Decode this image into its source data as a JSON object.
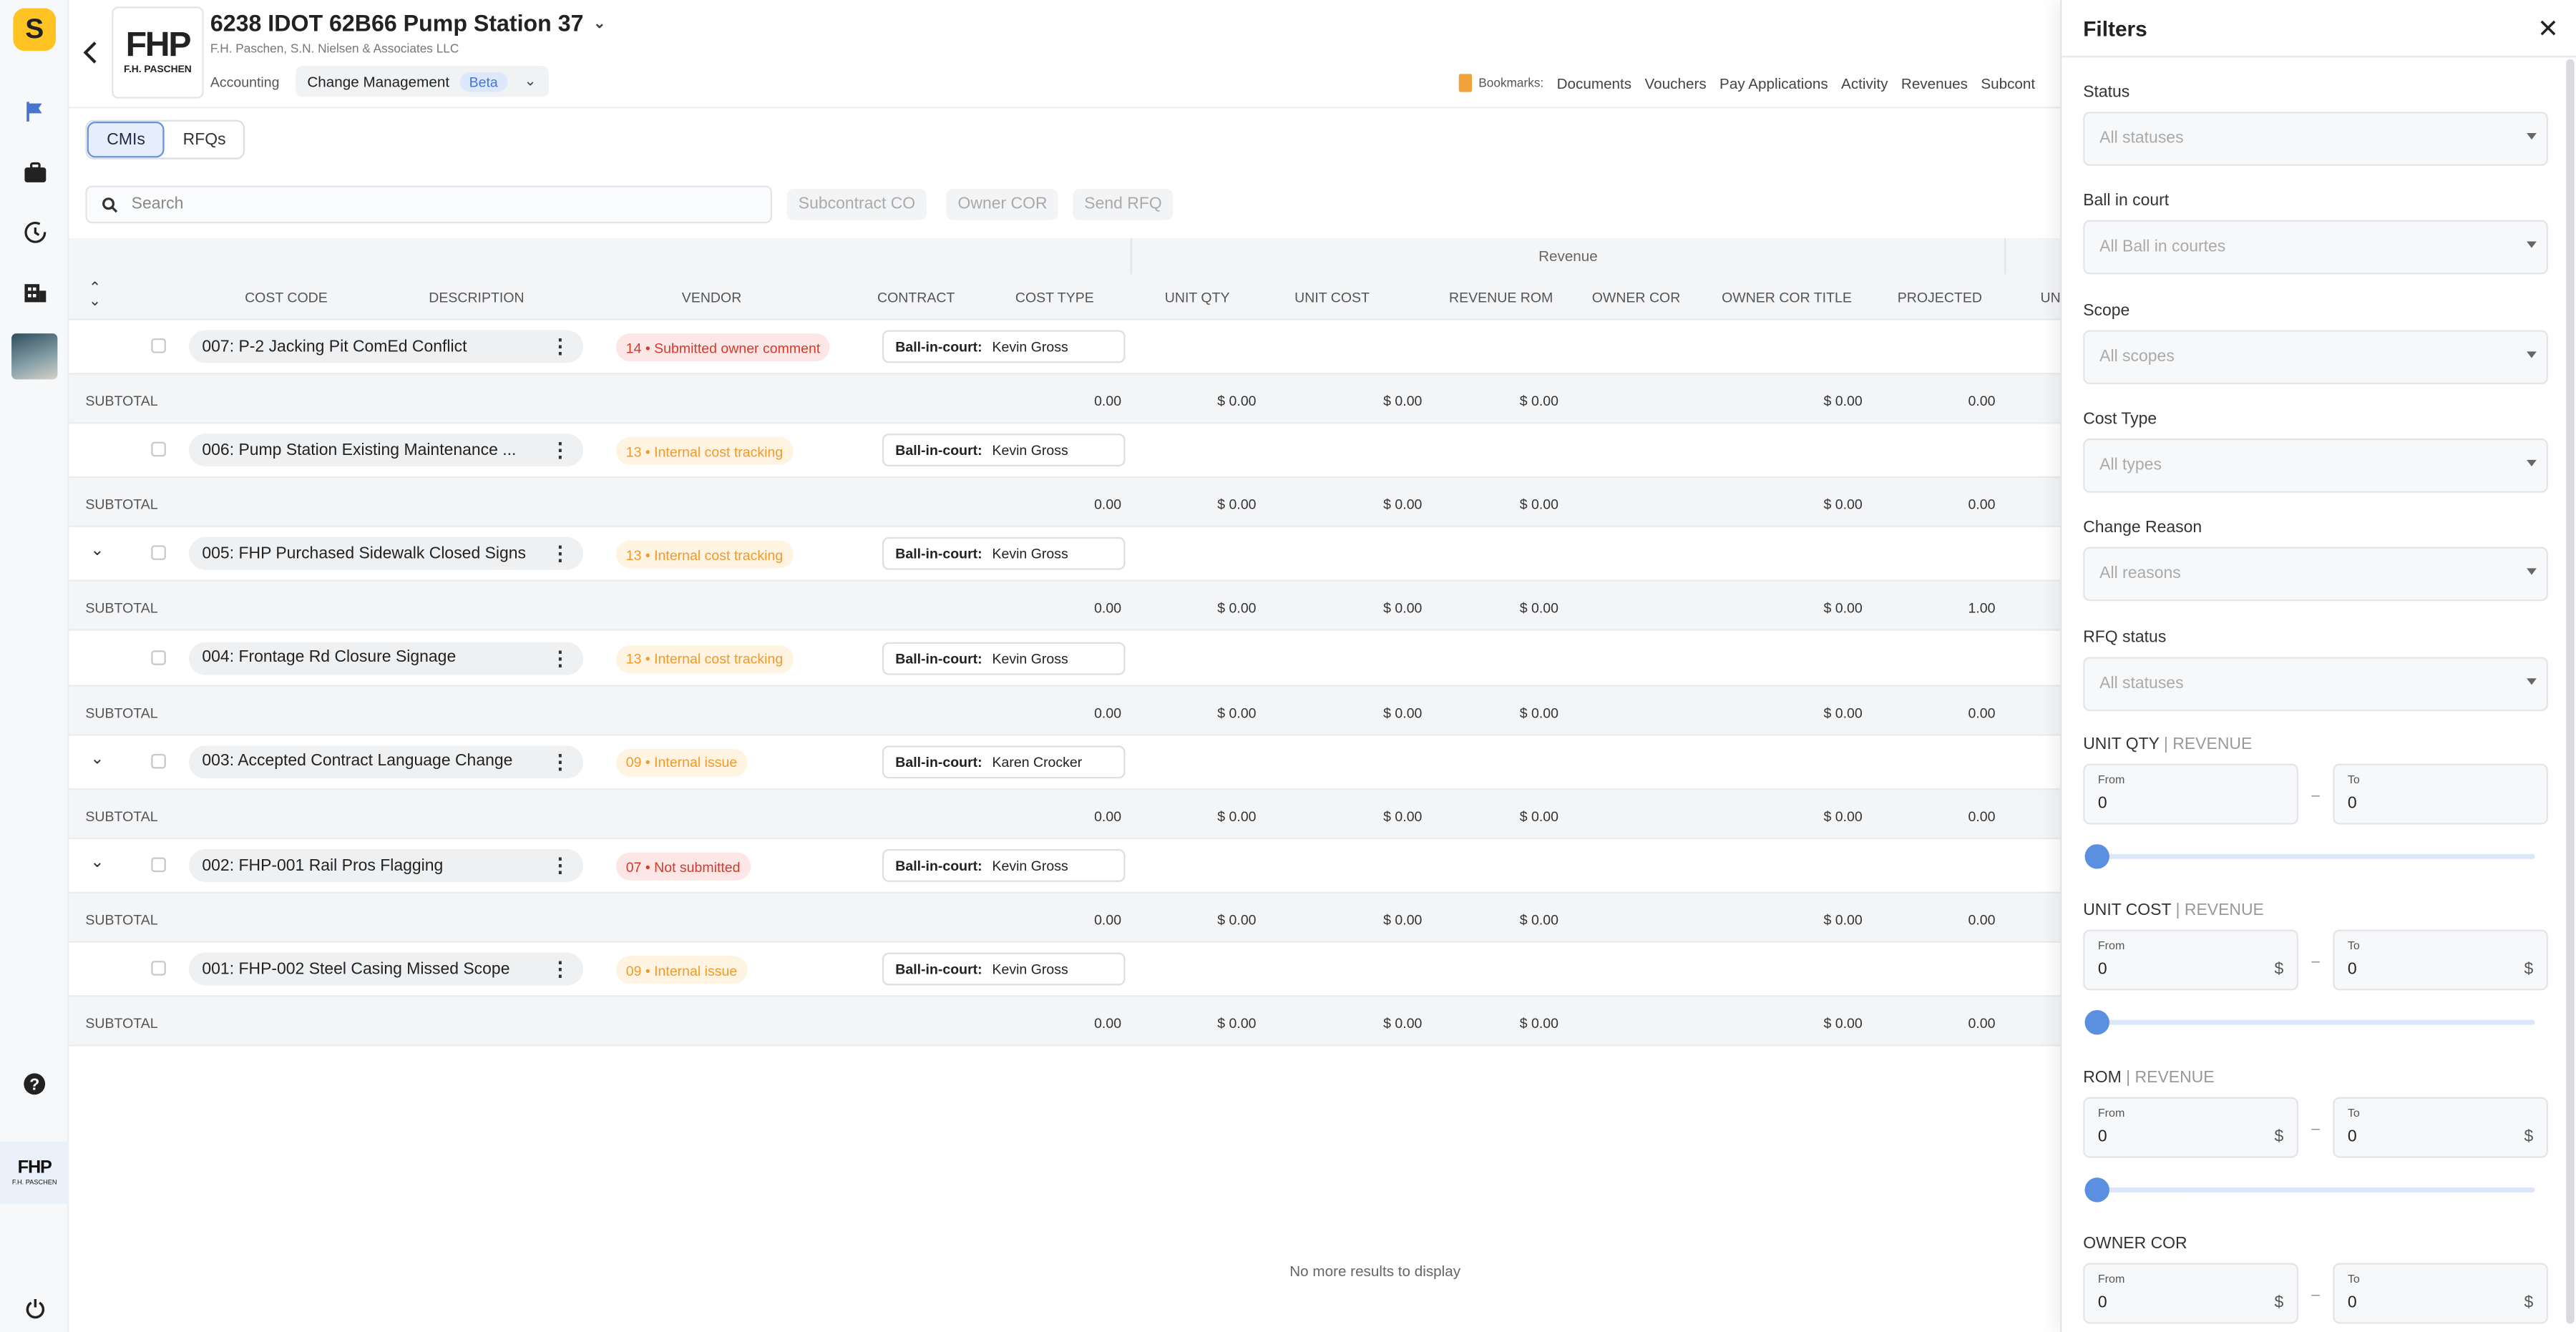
{
  "app": {
    "logo_letter": "S",
    "org_logo": "FHP",
    "org_logo_sub": "F.H. PASCHEN"
  },
  "header": {
    "title": "6238 IDOT 62B66 Pump Station 37",
    "subtitle": "F.H. Paschen, S.N. Nielsen & Associates LLC",
    "nav_accounting": "Accounting",
    "nav_change_management": "Change Management",
    "beta_label": "Beta",
    "bookmarks_label": "Bookmarks:",
    "bookmarks": [
      "Documents",
      "Vouchers",
      "Pay Applications",
      "Activity",
      "Revenues",
      "Subcont"
    ]
  },
  "tabs": [
    "CMIs",
    "RFQs"
  ],
  "search": {
    "placeholder": "Search"
  },
  "actions": [
    "Subcontract CO",
    "Owner COR",
    "Send RFQ"
  ],
  "table": {
    "group_header": "Revenue",
    "columns": [
      "COST CODE",
      "DESCRIPTION",
      "VENDOR",
      "CONTRACT",
      "COST TYPE",
      "UNIT QTY",
      "UNIT COST",
      "REVENUE ROM",
      "OWNER COR",
      "OWNER COR TITLE",
      "PROJECTED",
      "UN"
    ],
    "bic_label": "Ball-in-court:",
    "subtotal_label": "SUBTOTAL",
    "rows": [
      {
        "title": "007: P-2 Jacking Pit ComEd Conflict",
        "status": "14 • Submitted owner comment",
        "status_color": "red",
        "bic": "Kevin Gross",
        "expandable": false,
        "subtotal": {
          "unit_qty": "0.00",
          "unit_cost": "$ 0.00",
          "rom": "$ 0.00",
          "owner_cor": "$ 0.00",
          "projected": "$ 0.00",
          "un": "0.00"
        }
      },
      {
        "title": "006: Pump Station Existing Maintenance ...",
        "status": "13 • Internal cost tracking",
        "status_color": "orange",
        "bic": "Kevin Gross",
        "expandable": false,
        "subtotal": {
          "unit_qty": "0.00",
          "unit_cost": "$ 0.00",
          "rom": "$ 0.00",
          "owner_cor": "$ 0.00",
          "projected": "$ 0.00",
          "un": "0.00"
        }
      },
      {
        "title": "005: FHP Purchased Sidewalk Closed Signs",
        "status": "13 • Internal cost tracking",
        "status_color": "orange",
        "bic": "Kevin Gross",
        "expandable": true,
        "subtotal": {
          "unit_qty": "0.00",
          "unit_cost": "$ 0.00",
          "rom": "$ 0.00",
          "owner_cor": "$ 0.00",
          "projected": "$ 0.00",
          "un": "1.00"
        }
      },
      {
        "title": "004: Frontage Rd Closure Signage",
        "status": "13 • Internal cost tracking",
        "status_color": "orange",
        "bic": "Kevin Gross",
        "expandable": false,
        "subtotal": {
          "unit_qty": "0.00",
          "unit_cost": "$ 0.00",
          "rom": "$ 0.00",
          "owner_cor": "$ 0.00",
          "projected": "$ 0.00",
          "un": "0.00"
        }
      },
      {
        "title": "003: Accepted Contract Language Change",
        "status": "09 • Internal issue",
        "status_color": "orange",
        "bic": "Karen Crocker",
        "expandable": true,
        "subtotal": {
          "unit_qty": "0.00",
          "unit_cost": "$ 0.00",
          "rom": "$ 0.00",
          "owner_cor": "$ 0.00",
          "projected": "$ 0.00",
          "un": "0.00"
        }
      },
      {
        "title": "002: FHP-001 Rail Pros Flagging",
        "status": "07 • Not submitted",
        "status_color": "red",
        "bic": "Kevin Gross",
        "expandable": true,
        "subtotal": {
          "unit_qty": "0.00",
          "unit_cost": "$ 0.00",
          "rom": "$ 0.00",
          "owner_cor": "$ 0.00",
          "projected": "$ 0.00",
          "un": "0.00"
        }
      },
      {
        "title": "001: FHP-002 Steel Casing Missed Scope",
        "status": "09 • Internal issue",
        "status_color": "orange",
        "bic": "Kevin Gross",
        "expandable": false,
        "subtotal": {
          "unit_qty": "0.00",
          "unit_cost": "$ 0.00",
          "rom": "$ 0.00",
          "owner_cor": "$ 0.00",
          "projected": "$ 0.00",
          "un": "0.00"
        }
      }
    ],
    "footer": "No more results to display"
  },
  "filters": {
    "title": "Filters",
    "selects": [
      {
        "label": "Status",
        "placeholder": "All statuses"
      },
      {
        "label": "Ball in court",
        "placeholder": "All Ball in courtes"
      },
      {
        "label": "Scope",
        "placeholder": "All scopes"
      },
      {
        "label": "Cost Type",
        "placeholder": "All types"
      },
      {
        "label": "Change Reason",
        "placeholder": "All reasons"
      },
      {
        "label": "RFQ status",
        "placeholder": "All statuses"
      }
    ],
    "ranges": [
      {
        "label": "UNIT QTY",
        "suffix": "REVENUE",
        "from_label": "From",
        "to_label": "To",
        "from": "0",
        "to": "0",
        "unit": ""
      },
      {
        "label": "UNIT COST",
        "suffix": "REVENUE",
        "from_label": "From",
        "to_label": "To",
        "from": "0",
        "to": "0",
        "unit": "$"
      },
      {
        "label": "ROM",
        "suffix": "REVENUE",
        "from_label": "From",
        "to_label": "To",
        "from": "0",
        "to": "0",
        "unit": "$"
      },
      {
        "label": "OWNER COR",
        "suffix": "",
        "from_label": "From",
        "to_label": "To",
        "from": "0",
        "to": "0",
        "unit": "$"
      }
    ]
  },
  "colors": {
    "accent": "#5b8fe0",
    "brand": "#ffc423",
    "badge_red": "#d33a2c",
    "badge_orange": "#ef9a2c"
  }
}
